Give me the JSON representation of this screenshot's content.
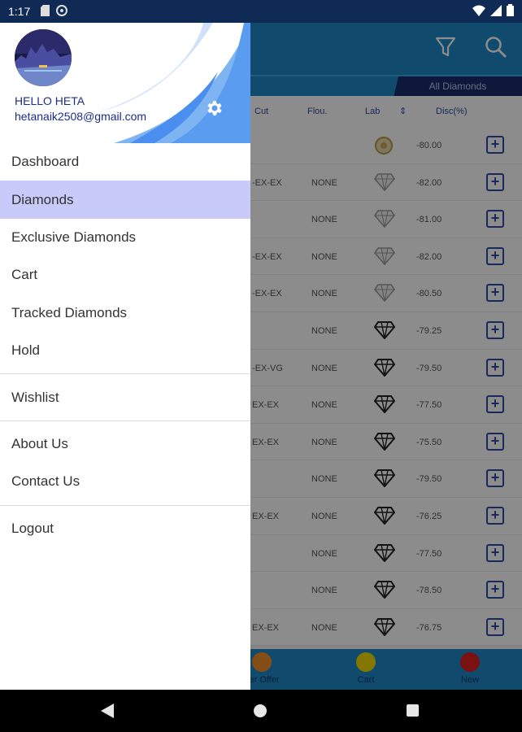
{
  "status_bar": {
    "time": "1:17"
  },
  "background": {
    "tab": "All Diamonds",
    "headers": {
      "cut": "Cut",
      "flou": "Flou.",
      "lab": "Lab",
      "disc": "Disc(%)"
    },
    "rows": [
      {
        "cut": "",
        "flou": "",
        "lab": "gia",
        "disc": "-80.00"
      },
      {
        "cut": "-EX-EX",
        "flou": "NONE",
        "lab": "diamond",
        "disc": "-82.00"
      },
      {
        "cut": "",
        "flou": "NONE",
        "lab": "diamond",
        "disc": "-81.00"
      },
      {
        "cut": "-EX-EX",
        "flou": "NONE",
        "lab": "diamond",
        "disc": "-82.00"
      },
      {
        "cut": "-EX-EX",
        "flou": "NONE",
        "lab": "diamond",
        "disc": "-80.50"
      },
      {
        "cut": "",
        "flou": "NONE",
        "lab": "diamond-dark",
        "disc": "-79.25"
      },
      {
        "cut": "-EX-VG",
        "flou": "NONE",
        "lab": "diamond-dark",
        "disc": "-79.50"
      },
      {
        "cut": "EX-EX",
        "flou": "NONE",
        "lab": "diamond-dark",
        "disc": "-77.50"
      },
      {
        "cut": "EX-EX",
        "flou": "NONE",
        "lab": "diamond-dark",
        "disc": "-75.50"
      },
      {
        "cut": "",
        "flou": "NONE",
        "lab": "diamond-dark",
        "disc": "-79.50"
      },
      {
        "cut": "EX-EX",
        "flou": "NONE",
        "lab": "diamond-dark",
        "disc": "-76.25"
      },
      {
        "cut": "",
        "flou": "NONE",
        "lab": "diamond-dark",
        "disc": "-77.50"
      },
      {
        "cut": "",
        "flou": "NONE",
        "lab": "diamond-dark",
        "disc": "-78.50"
      },
      {
        "cut": "EX-EX",
        "flou": "NONE",
        "lab": "diamond-dark",
        "disc": "-76.75"
      }
    ],
    "bottom_nav": [
      {
        "label": "der Offer",
        "color": "#f28c28"
      },
      {
        "label": "Cart",
        "color": "#f1d900"
      },
      {
        "label": "New",
        "color": "#e02020"
      }
    ]
  },
  "drawer": {
    "greeting": "HELLO HETA",
    "email": "hetanaik2508@gmail.com",
    "groups": [
      [
        {
          "label": "Dashboard",
          "active": false
        },
        {
          "label": "Diamonds",
          "active": true
        },
        {
          "label": "Exclusive Diamonds",
          "active": false
        },
        {
          "label": "Cart",
          "active": false
        },
        {
          "label": "Tracked Diamonds",
          "active": false
        },
        {
          "label": "Hold",
          "active": false
        }
      ],
      [
        {
          "label": "Wishlist",
          "active": false
        }
      ],
      [
        {
          "label": "About Us",
          "active": false
        },
        {
          "label": "Contact Us",
          "active": false
        }
      ],
      [
        {
          "label": "Logout",
          "active": false
        }
      ]
    ]
  },
  "colors": {
    "primary": "#1e88c7",
    "active_item": "#c8caf9",
    "header_text": "#1a2d8a"
  }
}
